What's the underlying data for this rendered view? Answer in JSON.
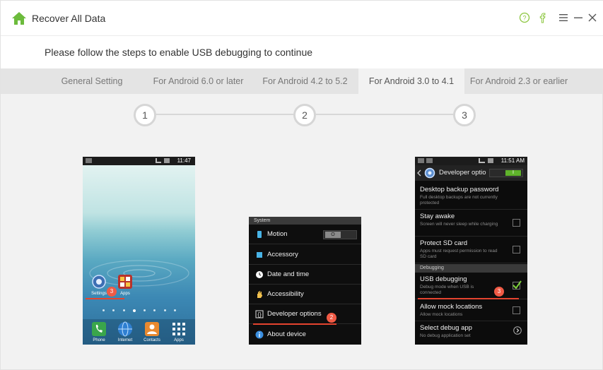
{
  "app": {
    "title": "Recover All Data",
    "accent": "#6cbb3c"
  },
  "window_controls": {
    "help_icon": "question-circle-icon",
    "facebook_icon": "facebook-icon",
    "menu_icon": "hamburger-menu-icon",
    "minimize_icon": "minimize-icon",
    "close_icon": "close-icon"
  },
  "instruction": "Please follow the steps to enable USB debugging to continue",
  "tabs": [
    {
      "label": "General Setting",
      "active": false
    },
    {
      "label": "For Android 6.0 or later",
      "active": false
    },
    {
      "label": "For Android 4.2 to 5.2",
      "active": false
    },
    {
      "label": "For Android 3.0 to 4.1",
      "active": true
    },
    {
      "label": "For Android 2.3 or earlier",
      "active": false
    }
  ],
  "steps": [
    "1",
    "2",
    "3"
  ],
  "phone1": {
    "status_time": "11:47",
    "apps": [
      {
        "label": "Settings",
        "icon": "settings-gear-icon"
      },
      {
        "label": "Apps",
        "icon": "apps-icon"
      }
    ],
    "dock": [
      {
        "label": "Phone",
        "icon": "phone-icon"
      },
      {
        "label": "Internet",
        "icon": "globe-icon"
      },
      {
        "label": "Contacts",
        "icon": "contacts-icon"
      },
      {
        "label": "Apps",
        "icon": "apps-grid-icon"
      }
    ],
    "badge": "3"
  },
  "phone2": {
    "section": "System",
    "rows": [
      {
        "label": "Motion",
        "icon": "motion-icon"
      },
      {
        "label": "Accessory",
        "icon": "accessory-icon"
      },
      {
        "label": "Date and time",
        "icon": "clock-icon"
      },
      {
        "label": "Accessibility",
        "icon": "hand-icon"
      },
      {
        "label": "Developer options",
        "icon": "braces-icon"
      },
      {
        "label": "About device",
        "icon": "info-icon"
      }
    ],
    "motion_toggle": "O",
    "badge": "2"
  },
  "phone3": {
    "status_time": "11:51 AM",
    "header_title": "Developer optio",
    "toggle": "I",
    "rows": [
      {
        "title": "Desktop backup password",
        "sub": "Full desktop backups are not currently protected"
      },
      {
        "title": "Stay awake",
        "sub": "Screen will never sleep while charging"
      },
      {
        "title": "Protect SD card",
        "sub": "Apps must request permission to read SD card"
      }
    ],
    "section": "Debugging",
    "debug_rows": [
      {
        "title": "USB debugging",
        "sub": "Debug mode when USB is connected",
        "checked": true
      },
      {
        "title": "Allow mock locations",
        "sub": "Allow mock locations",
        "checked": false
      },
      {
        "title": "Select debug app",
        "sub": "No debug application set"
      }
    ],
    "badge": "3"
  }
}
